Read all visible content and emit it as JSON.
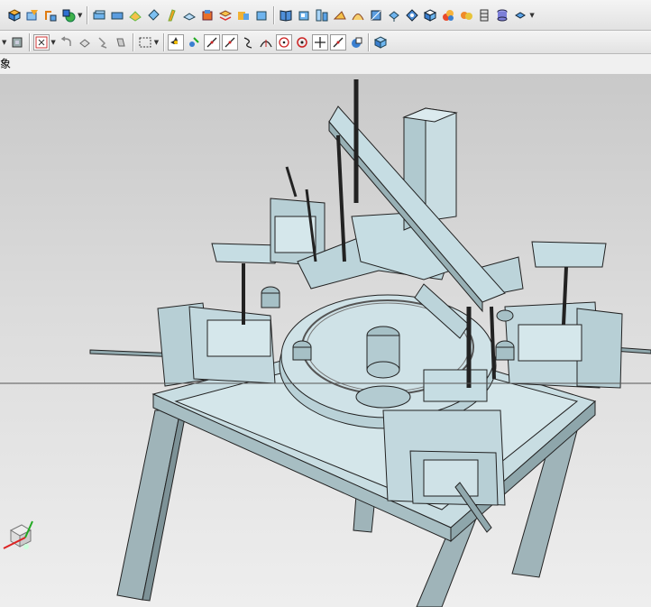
{
  "window": {
    "title": ""
  },
  "toolbar_top": {
    "icons": [
      "view-cube-icon",
      "sketch-icon",
      "feature-icon",
      "surface-icon",
      "box-icon",
      "plate-icon",
      "blend-icon",
      "chamfer-icon",
      "shell-icon",
      "draft-icon",
      "pattern-icon",
      "mirror-icon",
      "offset-icon",
      "book-icon",
      "part-icon",
      "assembly-icon",
      "sketch2-icon",
      "curve-icon",
      "sweep-icon",
      "extrude-icon",
      "orient-icon",
      "render-icon",
      "color-icon",
      "material-icon",
      "layer-icon",
      "cylinder-icon",
      "more-icon"
    ]
  },
  "toolbar_second": {
    "icons": [
      "filter-icon",
      "select-part-icon",
      "snap-icon",
      "undo-icon",
      "rotate-icon",
      "pan-icon",
      "box-select-icon",
      "point-snap-icon",
      "constraint-icon",
      "line-icon",
      "arc-icon",
      "arc-center-icon",
      "circle-center-icon",
      "circle-icon",
      "crosshair-icon",
      "tangent-icon",
      "quadrant-icon",
      "view-3d-icon"
    ]
  },
  "selection_bar": {
    "label": "象"
  },
  "viewport": {
    "background_top": "#c9c9c9",
    "background_bottom": "#eeeeee",
    "model_color": "#c6dde3",
    "edge_color": "#222222"
  }
}
